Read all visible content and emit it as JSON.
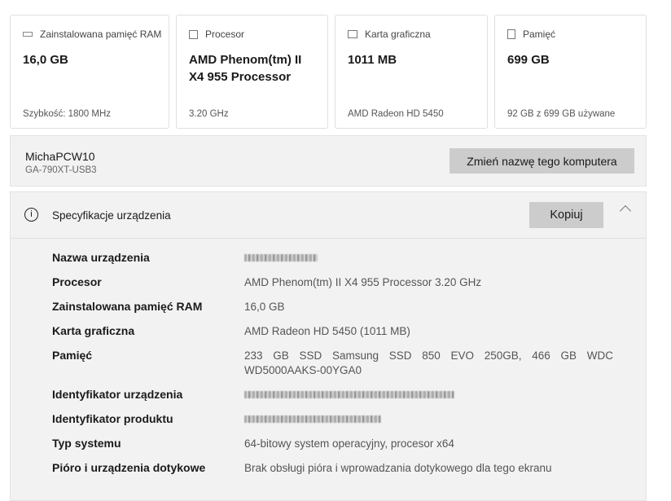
{
  "cards": [
    {
      "icon": "ram-icon",
      "title": "Zainstalowana pamięć RAM",
      "value": "16,0 GB",
      "sub": "Szybkość: 1800 MHz"
    },
    {
      "icon": "processor-icon",
      "title": "Procesor",
      "value": "AMD Phenom(tm) II X4 955 Processor",
      "sub": "3.20 GHz"
    },
    {
      "icon": "graphics-card-icon",
      "title": "Karta graficzna",
      "value": "1011 MB",
      "sub": "AMD Radeon HD 5450"
    },
    {
      "icon": "storage-icon",
      "title": "Pamięć",
      "value": "699 GB",
      "sub": "92 GB z 699 GB używane"
    }
  ],
  "computer": {
    "name": "MichaPCW10",
    "model": "GA-790XT-USB3",
    "rename_label": "Zmień nazwę tego komputera"
  },
  "specs": {
    "title": "Specyfikacje urządzenia",
    "copy_label": "Kopiuj",
    "rows": [
      {
        "label": "Nazwa urządzenia",
        "value": ""
      },
      {
        "label": "Procesor",
        "value": "AMD Phenom(tm) II X4 955 Processor   3.20 GHz"
      },
      {
        "label": "Zainstalowana pamięć RAM",
        "value": "16,0 GB"
      },
      {
        "label": "Karta graficzna",
        "value": "AMD Radeon HD 5450 (1011 MB)"
      },
      {
        "label": "Pamięć",
        "value": "233 GB SSD Samsung SSD 850 EVO 250GB, 466 GB WDC WD5000AAKS-00YGA0"
      },
      {
        "label": "Identyfikator urządzenia",
        "value": ""
      },
      {
        "label": "Identyfikator produktu",
        "value": ""
      },
      {
        "label": "Typ systemu",
        "value": "64-bitowy system operacyjny, procesor x64"
      },
      {
        "label": "Pióro i urządzenia dotykowe",
        "value": "Brak obsługi pióra i wprowadzania dotykowego dla tego ekranu"
      }
    ]
  }
}
